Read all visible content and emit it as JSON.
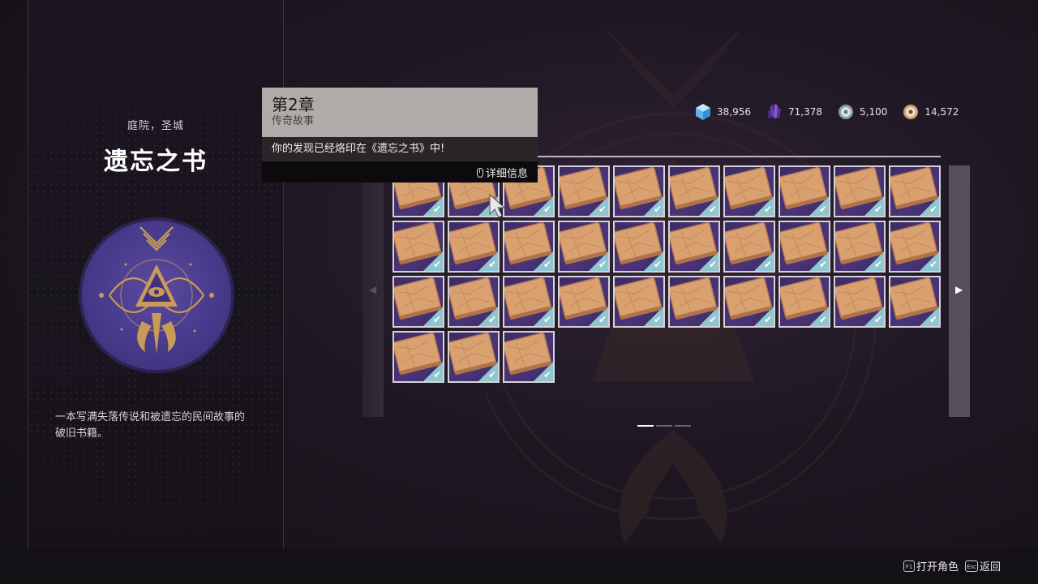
{
  "left_panel": {
    "location": "庭院，圣城",
    "title": "遗忘之书",
    "description": "一本写满失落传说和被遗忘的民间故事的破旧书籍。"
  },
  "tooltip": {
    "title": "第2章",
    "subtitle": "传奇故事",
    "message": "你的发现已经烙印在《遗忘之书》中!",
    "detail_label": "详细信息"
  },
  "currencies": [
    {
      "icon": "blue-cube-icon",
      "value": "38,956"
    },
    {
      "icon": "purple-crystal-icon",
      "value": "71,378"
    },
    {
      "icon": "silver-orb-icon",
      "value": "5,100"
    },
    {
      "icon": "bronze-coin-icon",
      "value": "14,572"
    }
  ],
  "grid": {
    "item_count": 33,
    "columns": 10,
    "all_collected": true,
    "check_glyph": "✔"
  },
  "pager": {
    "pages": 3,
    "current": 1
  },
  "hotkeys": [
    {
      "key": "F1",
      "label": "打开角色"
    },
    {
      "key": "Esc",
      "label": "返回"
    }
  ],
  "colors": {
    "tile_accent": "#8fc6cf",
    "tile_purple": "#4a3478",
    "tooltip_header": "#b0aaa8"
  }
}
